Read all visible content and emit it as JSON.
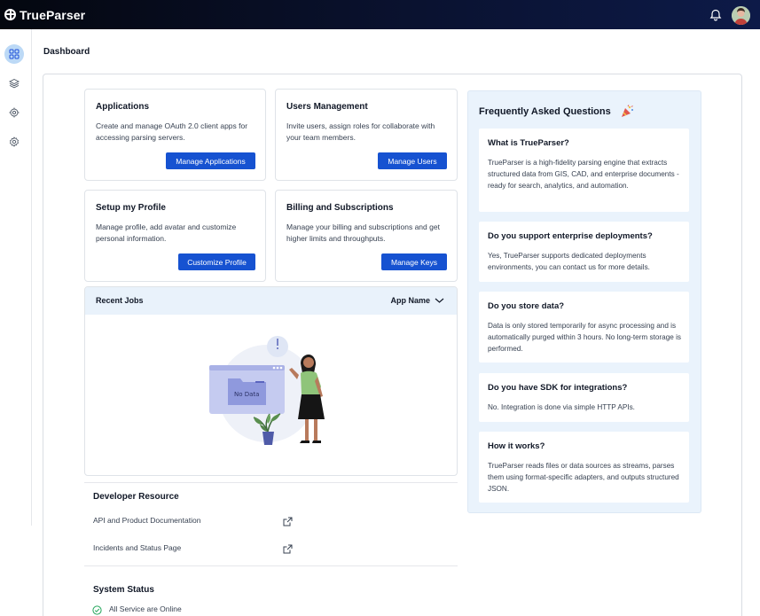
{
  "app": {
    "name": "TrueParser"
  },
  "page": {
    "title": "Dashboard"
  },
  "cards": [
    {
      "title": "Applications",
      "description": "Create and manage OAuth 2.0 client apps for accessing parsing servers.",
      "button": "Manage Applications"
    },
    {
      "title": "Users Management",
      "description": "Invite users, assign roles for collaborate with your team members.",
      "button": "Manage Users"
    },
    {
      "title": "Setup my Profile",
      "description": "Manage profile, add avatar and customize personal information.",
      "button": "Customize Profile"
    },
    {
      "title": "Billing and Subscriptions",
      "description": "Manage your billing and subscriptions and get higher limits and throughputs.",
      "button": "Manage Keys"
    }
  ],
  "recent_jobs": {
    "title": "Recent Jobs",
    "filter": "App Name",
    "empty_label": "No Data"
  },
  "developer": {
    "title": "Developer Resource",
    "links": [
      "API and Product Documentation",
      "Incidents and Status Page"
    ]
  },
  "system_status": {
    "title": "System Status",
    "status": "All Service are Online"
  },
  "faq": {
    "title": "Frequently Asked Questions",
    "items": [
      {
        "q": "What is TrueParser?",
        "a": "TrueParser is a high-fidelity parsing engine that extracts structured data from GIS, CAD, and enterprise documents - ready for search, analytics, and automation."
      },
      {
        "q": "Do you support enterprise deployments?",
        "a": "Yes, TrueParser supports dedicated deployments environments, you can contact us for more details."
      },
      {
        "q": "Do you store data?",
        "a": "Data is only stored temporarily for async processing and is automatically purged within 3 hours. No long-term storage is performed."
      },
      {
        "q": "Do you have SDK for integrations?",
        "a": "No. Integration is done via simple HTTP APIs."
      },
      {
        "q": "How it works?",
        "a": "TrueParser reads files or data sources as streams, parses them using format-specific adapters, and outputs structured JSON."
      }
    ]
  },
  "colors": {
    "accent": "#1652d1",
    "faq_bg": "#eaf3fc",
    "jobs_header": "#e9f2fb",
    "status_ok": "#22a55a"
  },
  "icons": [
    "grid-icon",
    "layers-icon",
    "target-icon",
    "gear-icon",
    "bell-icon",
    "external-link-icon",
    "check-circle-icon",
    "chevron-down-icon",
    "party-popper-icon"
  ]
}
